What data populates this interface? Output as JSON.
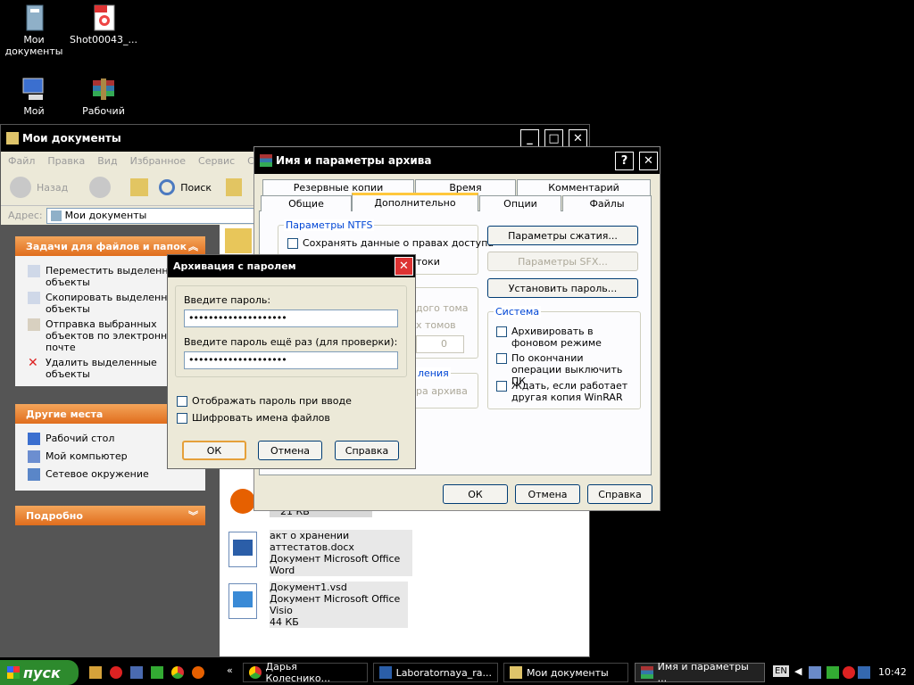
{
  "desktop": {
    "icons": [
      {
        "label": "Мои\nдокументы"
      },
      {
        "label": "Shot00043_..."
      },
      {
        "label": "Мой"
      },
      {
        "label": "Рабочий"
      }
    ]
  },
  "explorer": {
    "title": "Мои документы",
    "menu": [
      "Файл",
      "Правка",
      "Вид",
      "Избранное",
      "Сервис",
      "Спр"
    ],
    "toolbar": {
      "back": "Назад",
      "search": "Поиск"
    },
    "address_label": "Адрес:",
    "address_value": "Мои документы",
    "tasks_header": "Задачи для файлов и папок",
    "tasks": [
      "Переместить выделенные объекты",
      "Скопировать выделенные объекты",
      "Отправка выбранных объектов по электронной почте",
      "Удалить выделенные объекты"
    ],
    "places_header": "Другие места",
    "places": [
      "Рабочий стол",
      "Мой компьютер",
      "Сетевое окружение"
    ],
    "details_header": "Подробно",
    "files": [
      {
        "name": "акт о хранении аттестатов.docx",
        "type": "Документ Microsoft Office Word",
        "size": ""
      },
      {
        "name": "Документ1.vsd",
        "type": "Документ Microsoft Office Visio",
        "size": "44 КБ"
      }
    ],
    "partial_size": "21 КБ"
  },
  "archive": {
    "title": "Имя и параметры архива",
    "tabs_row1": [
      "Резервные копии",
      "Время",
      "Комментарий"
    ],
    "tabs_row2": [
      "Общие",
      "Дополнительно",
      "Опции",
      "Файлы"
    ],
    "ntfs_group": "Параметры NTFS",
    "ntfs_save": "Сохранять данные о правах доступа",
    "ntfs_partial": "токи",
    "vol_partial1": "дого тома",
    "vol_partial2": "х томов",
    "vol_spin": "0",
    "rec_partial1": "ления",
    "rec_partial2": "ра архива",
    "btn_compress": "Параметры сжатия...",
    "btn_sfx": "Параметры SFX...",
    "btn_password": "Установить пароль...",
    "system_group": "Система",
    "sys_bg": "Архивировать в фоновом режиме",
    "sys_shutdown": "По окончании операции выключить ПК",
    "sys_wait": "Ждать, если работает другая копия WinRAR",
    "ok": "ОК",
    "cancel": "Отмена",
    "help": "Справка"
  },
  "password": {
    "title": "Архивация с паролем",
    "enter_label": "Введите пароль:",
    "enter_value": "••••••••••••••••••••",
    "reenter_label": "Введите пароль ещё раз (для проверки):",
    "reenter_value": "••••••••••••••••••••",
    "show_pw": "Отображать пароль при вводе",
    "encrypt_names": "Шифровать имена файлов",
    "ok": "ОК",
    "cancel": "Отмена",
    "help": "Справка"
  },
  "taskbar": {
    "start": "пуск",
    "tasks": [
      "Дарья Колеснико...",
      "Laboratornaya_ra...",
      "Мои документы",
      "Имя и параметры ..."
    ],
    "lang": "EN",
    "clock": "10:42"
  }
}
